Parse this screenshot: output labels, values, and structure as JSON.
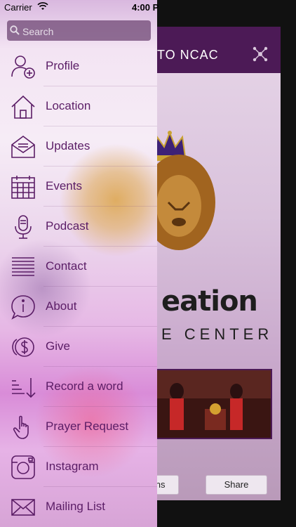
{
  "status_bar": {
    "carrier": "Carrier",
    "time": "4:00 P"
  },
  "background_app": {
    "header_title": "TO NCAC",
    "logo_word": "eation",
    "logo_subtitle": "E CENTER",
    "button_left_label": "ons",
    "share_label": "Share",
    "header_color": "#4c1a56"
  },
  "menu": {
    "search_placeholder": "Search",
    "items": [
      {
        "label": "Profile",
        "icon": "profile-add-icon"
      },
      {
        "label": "Location",
        "icon": "home-icon"
      },
      {
        "label": "Updates",
        "icon": "envelope-open-icon"
      },
      {
        "label": "Events",
        "icon": "calendar-icon"
      },
      {
        "label": "Podcast",
        "icon": "microphone-icon"
      },
      {
        "label": "Contact",
        "icon": "lines-icon"
      },
      {
        "label": "About",
        "icon": "info-bubble-icon"
      },
      {
        "label": "Give",
        "icon": "coins-icon"
      },
      {
        "label": "Record a word",
        "icon": "sort-down-icon"
      },
      {
        "label": "Prayer Request",
        "icon": "hand-pointer-icon"
      },
      {
        "label": "Instagram",
        "icon": "instagram-icon"
      },
      {
        "label": "Mailing List",
        "icon": "mail-icon"
      }
    ],
    "accent_color": "#5b1d66"
  }
}
